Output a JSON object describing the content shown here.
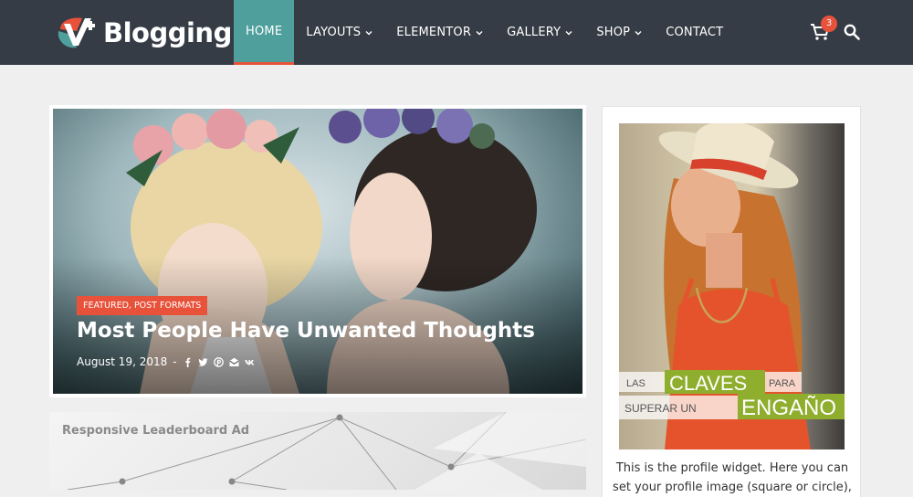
{
  "header": {
    "logo_text": "Blogging",
    "nav": [
      {
        "label": "HOME",
        "active": true,
        "dropdown": false
      },
      {
        "label": "LAYOUTS",
        "active": false,
        "dropdown": true
      },
      {
        "label": "ELEMENTOR",
        "active": false,
        "dropdown": true
      },
      {
        "label": "GALLERY",
        "active": false,
        "dropdown": true
      },
      {
        "label": "SHOP",
        "active": false,
        "dropdown": true
      },
      {
        "label": "CONTACT",
        "active": false,
        "dropdown": false
      }
    ],
    "cart_count": "3",
    "icons": [
      "cart-icon",
      "search-icon"
    ]
  },
  "featured": {
    "category": "FEATURED, POST FORMATS",
    "title": "Most People Have Unwanted Thoughts",
    "date": "August 19, 2018",
    "separator": "-",
    "share_icons": [
      "facebook-icon",
      "twitter-icon",
      "pinterest-icon",
      "email-icon",
      "vk-icon"
    ]
  },
  "ad": {
    "label": "Responsive Leaderboard Ad"
  },
  "sidebar": {
    "poster": {
      "w1": "LAS",
      "w2": "CLAVES",
      "w3": "PARA",
      "w4": "SUPERAR UN",
      "w5": "ENGAÑO"
    },
    "profile_text": "This is the profile widget. Here you can set your profile image (square or circle),"
  },
  "colors": {
    "header_bg": "#363c45",
    "accent_teal": "#4f9f9d",
    "accent_red": "#e8523a",
    "page_bg": "#efefef",
    "poster_green": "#8fae2e"
  }
}
